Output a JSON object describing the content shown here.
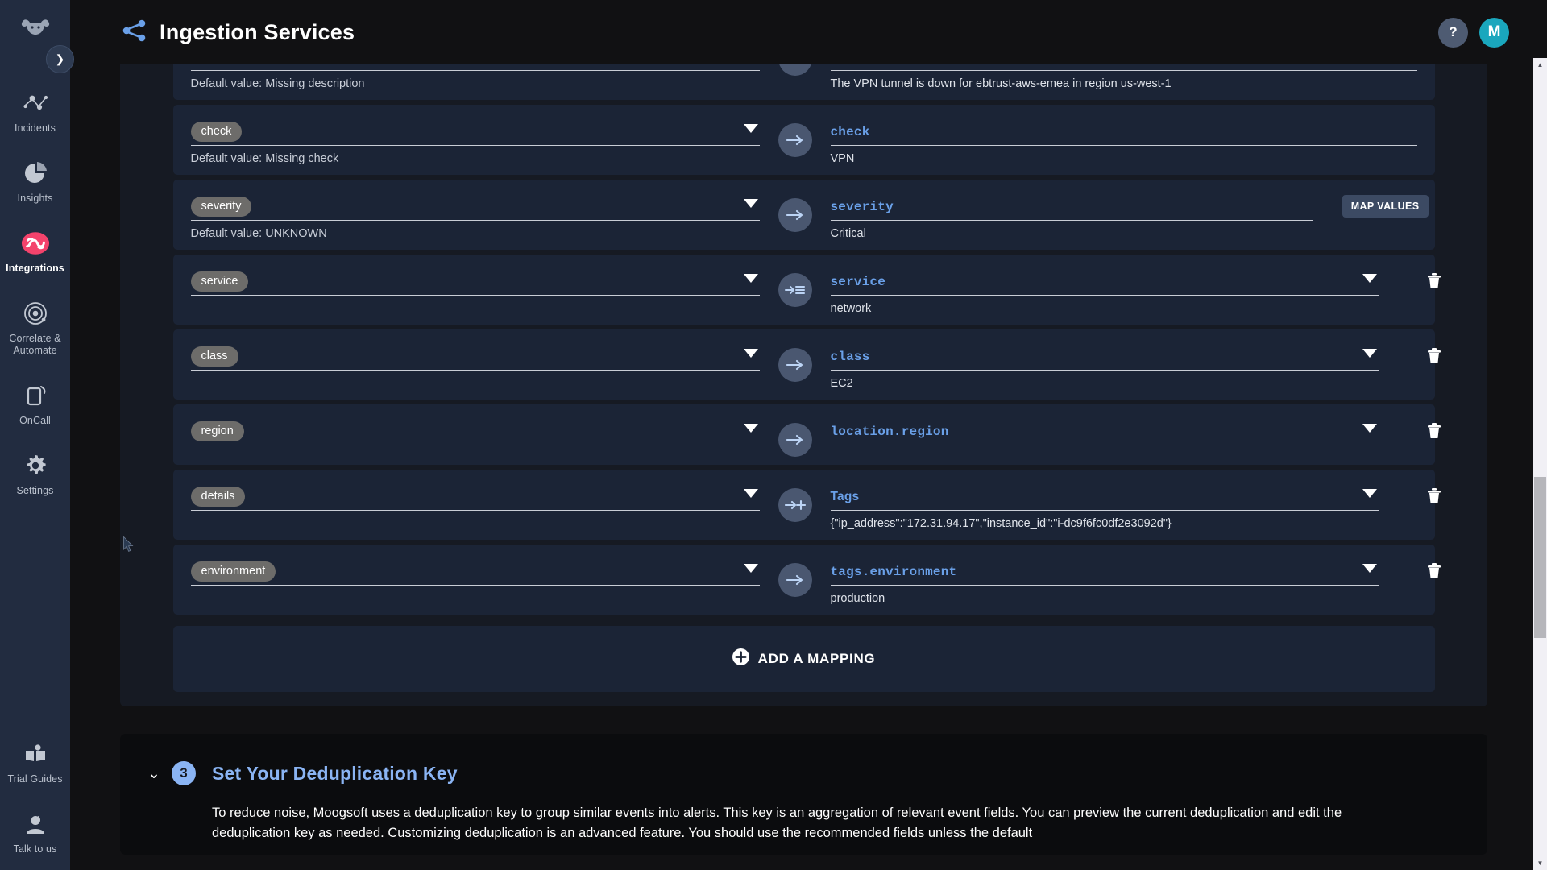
{
  "header": {
    "title": "Ingestion Services",
    "logo_icon": "share-nodes-icon",
    "help_label": "?",
    "avatar_label": "M"
  },
  "sidebar": {
    "logo_icon": "moogsoft-cow-icon",
    "toggle_icon": "chevron-right-icon",
    "items": [
      {
        "label": "Incidents",
        "icon": "incidents-scatter-icon",
        "active": false
      },
      {
        "label": "Insights",
        "icon": "pie-chart-icon",
        "active": false
      },
      {
        "label": "Integrations",
        "icon": "integrations-icon",
        "active": true
      },
      {
        "label": "Correlate & Automate",
        "icon": "target-spiral-icon",
        "active": false
      },
      {
        "label": "OnCall",
        "icon": "mobile-phone-icon",
        "active": false
      },
      {
        "label": "Settings",
        "icon": "gear-icon",
        "active": false
      }
    ],
    "bottom_items": [
      {
        "label": "Trial Guides",
        "icon": "open-book-icon"
      },
      {
        "label": "Talk to us",
        "icon": "person-support-icon"
      }
    ]
  },
  "mappings": {
    "rows": [
      {
        "source_pill": "",
        "source_default": "Default value: Missing description",
        "arrow_icon": "arrow-right-icon",
        "target_name": "",
        "target_value": "The VPN tunnel is down for ebtrust-aws-emea in region us-west-1",
        "has_caret": false,
        "has_target_caret": false,
        "has_trash": false,
        "has_map_values": false,
        "clipped": true
      },
      {
        "source_pill": "check",
        "source_default": "Default value: Missing check",
        "arrow_icon": "arrow-right-icon",
        "target_name": "check",
        "target_value": "VPN",
        "has_caret": true,
        "has_target_caret": false,
        "has_trash": false,
        "has_map_values": false,
        "clipped": false
      },
      {
        "source_pill": "severity",
        "source_default": "Default value: UNKNOWN",
        "arrow_icon": "arrow-right-icon",
        "target_name": "severity",
        "target_value": "Critical",
        "has_caret": true,
        "has_target_caret": false,
        "has_trash": false,
        "has_map_values": true,
        "map_values_label": "MAP VALUES",
        "clipped": false
      },
      {
        "source_pill": "service",
        "source_default": "",
        "arrow_icon": "arrow-right-list-icon",
        "target_name": "service",
        "target_value": "network",
        "has_caret": true,
        "has_target_caret": true,
        "has_trash": true,
        "has_map_values": false,
        "clipped": false
      },
      {
        "source_pill": "class",
        "source_default": "",
        "arrow_icon": "arrow-right-icon",
        "target_name": "class",
        "target_value": "EC2",
        "has_caret": true,
        "has_target_caret": true,
        "has_trash": true,
        "has_map_values": false,
        "clipped": false
      },
      {
        "source_pill": "region",
        "source_default": "",
        "arrow_icon": "arrow-right-icon",
        "target_name": "location.region",
        "target_value": "",
        "has_caret": true,
        "has_target_caret": true,
        "has_trash": true,
        "has_map_values": false,
        "clipped": false
      },
      {
        "source_pill": "details",
        "source_default": "",
        "arrow_icon": "arrow-right-plus-icon",
        "target_name": "Tags",
        "target_name_plain": true,
        "target_value": "{\"ip_address\":\"172.31.94.17\",\"instance_id\":\"i-dc9f6fc0df2e3092d\"}",
        "has_caret": true,
        "has_target_caret": true,
        "has_trash": true,
        "has_map_values": false,
        "clipped": false
      },
      {
        "source_pill": "environment",
        "source_default": "",
        "arrow_icon": "arrow-right-icon",
        "target_name": "tags.environment",
        "target_value": "production",
        "has_caret": true,
        "has_target_caret": true,
        "has_trash": true,
        "has_map_values": false,
        "clipped": false
      }
    ],
    "add_mapping_label": "ADD A MAPPING",
    "add_mapping_icon": "plus-circle-icon"
  },
  "step3": {
    "chevron_icon": "chevron-down-icon",
    "number": "3",
    "title": "Set Your Deduplication Key",
    "body": "To reduce noise, Moogsoft uses a deduplication key to group similar events into alerts. This key is an aggregation of relevant event fields. You can preview the current deduplication and edit the deduplication key as needed. Customizing deduplication is an advanced feature. You should use the recommended fields unless the default"
  },
  "colors": {
    "page_bg": "#111113",
    "rail_bg": "#222c40",
    "row_bg": "#1b2436",
    "accent_blue": "#6aa0e8",
    "step_blue": "#8ab4f3",
    "brand_pink": "#f4436c",
    "avatar_teal": "#1aa7bd"
  }
}
